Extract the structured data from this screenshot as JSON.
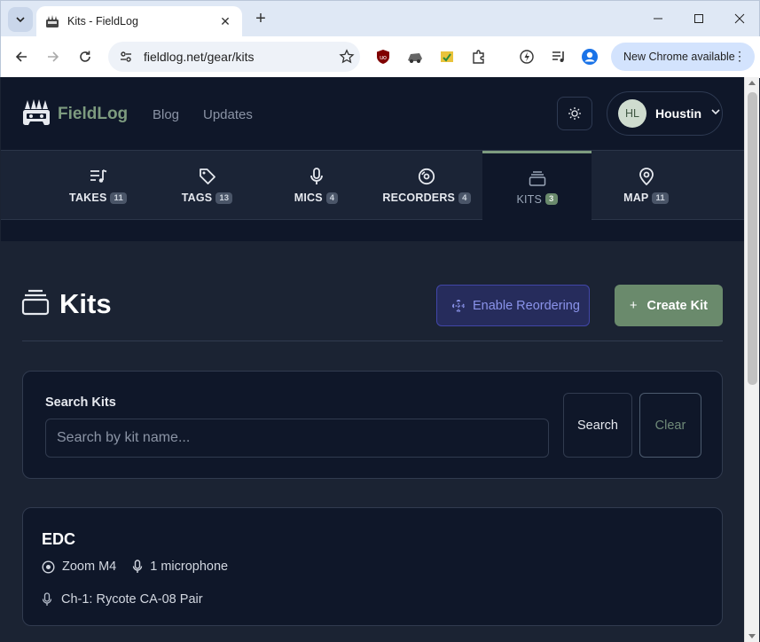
{
  "browser": {
    "tab_title": "Kits - FieldLog",
    "url": "fieldlog.net/gear/kits",
    "new_chrome_label": "New Chrome available"
  },
  "header": {
    "brand": "FieldLog",
    "nav": [
      "Blog",
      "Updates"
    ],
    "user": {
      "initials": "HL",
      "name": "Houstin"
    }
  },
  "gear_tabs": [
    {
      "label": "TAKES",
      "count": "11",
      "icon": "music-list-icon"
    },
    {
      "label": "TAGS",
      "count": "13",
      "icon": "tag-icon"
    },
    {
      "label": "MICS",
      "count": "4",
      "icon": "microphone-icon"
    },
    {
      "label": "RECORDERS",
      "count": "4",
      "icon": "disc-icon"
    },
    {
      "label": "KITS",
      "count": "3",
      "icon": "layers-icon",
      "active": true
    },
    {
      "label": "MAP",
      "count": "11",
      "icon": "map-pin-icon"
    }
  ],
  "main": {
    "title": "Kits",
    "reorder_label": "Enable Reordering",
    "create_label": "Create Kit",
    "create_prefix": "+"
  },
  "search": {
    "label": "Search Kits",
    "placeholder": "Search by kit name...",
    "search_label": "Search",
    "clear_label": "Clear"
  },
  "kits": [
    {
      "name": "EDC",
      "recorder": "Zoom M4",
      "mic_count": "1 microphone",
      "channels": [
        "Ch-1: Rycote CA-08 Pair"
      ]
    }
  ],
  "colors": {
    "accent": "#6a8a6c",
    "brand_text": "#7d9b7f",
    "header_bg": "#0f1729",
    "page_bg": "#1b2333",
    "reorder_text": "#8a93ea"
  }
}
